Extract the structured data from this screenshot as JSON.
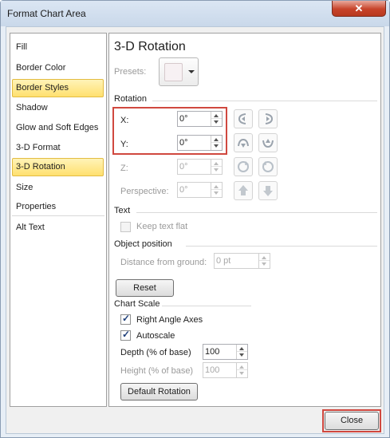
{
  "window": {
    "title": "Format Chart Area",
    "close_glyph": "✕"
  },
  "nav": {
    "items": [
      {
        "label": "Fill"
      },
      {
        "label": "Border Color"
      },
      {
        "label": "Border Styles"
      },
      {
        "label": "Shadow"
      },
      {
        "label": "Glow and Soft Edges"
      },
      {
        "label": "3-D Format"
      },
      {
        "label": "3-D Rotation"
      },
      {
        "label": "Size"
      },
      {
        "label": "Properties"
      },
      {
        "label": "Alt Text"
      }
    ],
    "selected": "3-D Rotation"
  },
  "panel": {
    "heading": "3-D Rotation",
    "presets_label": "Presets:",
    "rotation": {
      "section": "Rotation",
      "x_label": "X:",
      "x_value": "0°",
      "y_label": "Y:",
      "y_value": "0°",
      "z_label": "Z:",
      "z_value": "0°",
      "perspective_label": "Perspective:",
      "perspective_value": "0°"
    },
    "text": {
      "section": "Text",
      "keep_flat_label": "Keep text flat"
    },
    "object_position": {
      "section": "Object position",
      "distance_label": "Distance from ground:",
      "distance_value": "0 pt",
      "reset_label": "Reset"
    },
    "chart_scale": {
      "section": "Chart Scale",
      "right_angle_label": "Right Angle Axes",
      "right_angle_checked": true,
      "autoscale_label": "Autoscale",
      "autoscale_checked": true,
      "depth_label": "Depth (% of base)",
      "depth_value": "100",
      "height_label": "Height (% of base)",
      "height_value": "100",
      "default_rotation_label": "Default Rotation"
    }
  },
  "footer": {
    "close_label": "Close"
  },
  "colors": {
    "highlight": "#d0483f",
    "selected_nav": "#ffe06f"
  }
}
